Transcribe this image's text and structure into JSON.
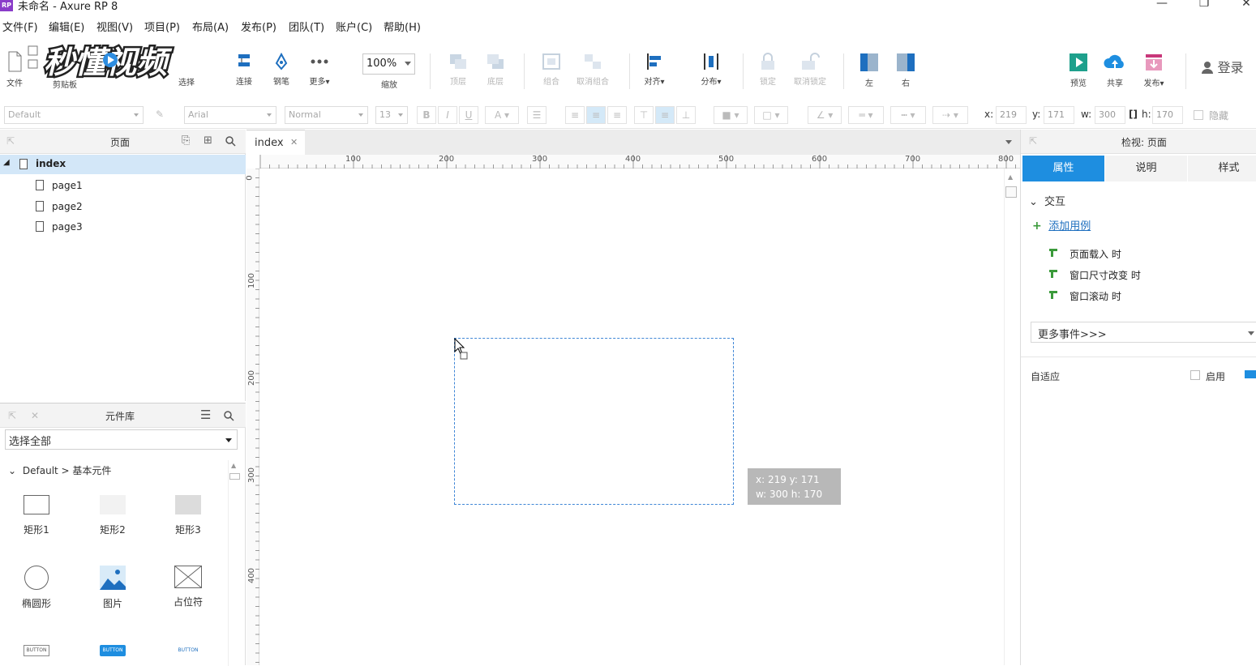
{
  "window": {
    "title": "未命名 - Axure RP 8",
    "app_icon": "RP"
  },
  "menu": [
    "文件(F)",
    "编辑(E)",
    "视图(V)",
    "项目(P)",
    "布局(A)",
    "发布(P)",
    "团队(T)",
    "账户(C)",
    "帮助(H)"
  ],
  "toolbar": {
    "file_label": "文件",
    "clipboard_label": "剪贴板",
    "select_label": "选择",
    "connect_label": "连接",
    "pen_label": "钢笔",
    "more_label": "更多▾",
    "zoom_value": "100%",
    "zoom_label": "缩放",
    "top_label": "顶层",
    "bottom_label": "底层",
    "group_label": "组合",
    "ungroup_label": "取消组合",
    "align_label": "对齐▾",
    "distribute_label": "分布▾",
    "lock_label": "锁定",
    "unlock_label": "取消锁定",
    "left_label": "左",
    "right_label": "右",
    "preview_label": "预览",
    "share_label": "共享",
    "publish_label": "发布▾",
    "login_label": "登录",
    "watermark_text": "秒懂视频"
  },
  "formatbar": {
    "style_value": "Default",
    "font_value": "Arial",
    "weight_value": "Normal",
    "size_value": "13",
    "bold": "B",
    "italic": "I",
    "underline": "U",
    "x_label": "x:",
    "x_value": "219",
    "y_label": "y:",
    "y_value": "171",
    "w_label": "w:",
    "w_value": "300",
    "h_label": "h:",
    "h_value": "170",
    "hidden_label": "隐藏"
  },
  "pages_panel": {
    "title": "页面",
    "pages": [
      {
        "label": "index",
        "selected": true
      },
      {
        "label": "page1"
      },
      {
        "label": "page2"
      },
      {
        "label": "page3"
      }
    ]
  },
  "library_panel": {
    "title": "元件库",
    "filter_value": "选择全部",
    "group_label": "Default > 基本元件",
    "widgets": [
      {
        "label": "矩形1",
        "icon": "rectangle-outline-icon"
      },
      {
        "label": "矩形2",
        "icon": "rectangle-light-icon"
      },
      {
        "label": "矩形3",
        "icon": "rectangle-gray-icon"
      },
      {
        "label": "椭圆形",
        "icon": "ellipse-icon"
      },
      {
        "label": "图片",
        "icon": "image-icon"
      },
      {
        "label": "占位符",
        "icon": "placeholder-icon"
      },
      {
        "label": "BUTTON",
        "icon": "button-icon"
      },
      {
        "label": "BUTTON",
        "icon": "primary-button-icon"
      },
      {
        "label": "BUTTON",
        "icon": "link-button-icon"
      }
    ]
  },
  "canvas": {
    "tab_label": "index",
    "h_ruler": [
      "100",
      "200",
      "300",
      "400",
      "500",
      "600",
      "700",
      "800"
    ],
    "v_ruler": [
      "0",
      "100",
      "200",
      "300",
      "400"
    ],
    "tooltip_line1": "x: 219   y: 171",
    "tooltip_line2": "w: 300   h: 170"
  },
  "inspector": {
    "title": "检视: 页面",
    "tabs": [
      "属性",
      "说明",
      "样式"
    ],
    "interaction_label": "交互",
    "add_case_label": "添加用例",
    "events": [
      "页面载入 时",
      "窗口尺寸改变 时",
      "窗口滚动 时"
    ],
    "more_events_value": "更多事件>>>",
    "adaptive_label": "自适应",
    "enable_label": "启用"
  },
  "colors": {
    "accent": "#1e8ee0",
    "selection": "#d3e7f8",
    "tooltip_bg": "#b8b8b8",
    "event_icon": "#3a9a3a"
  }
}
